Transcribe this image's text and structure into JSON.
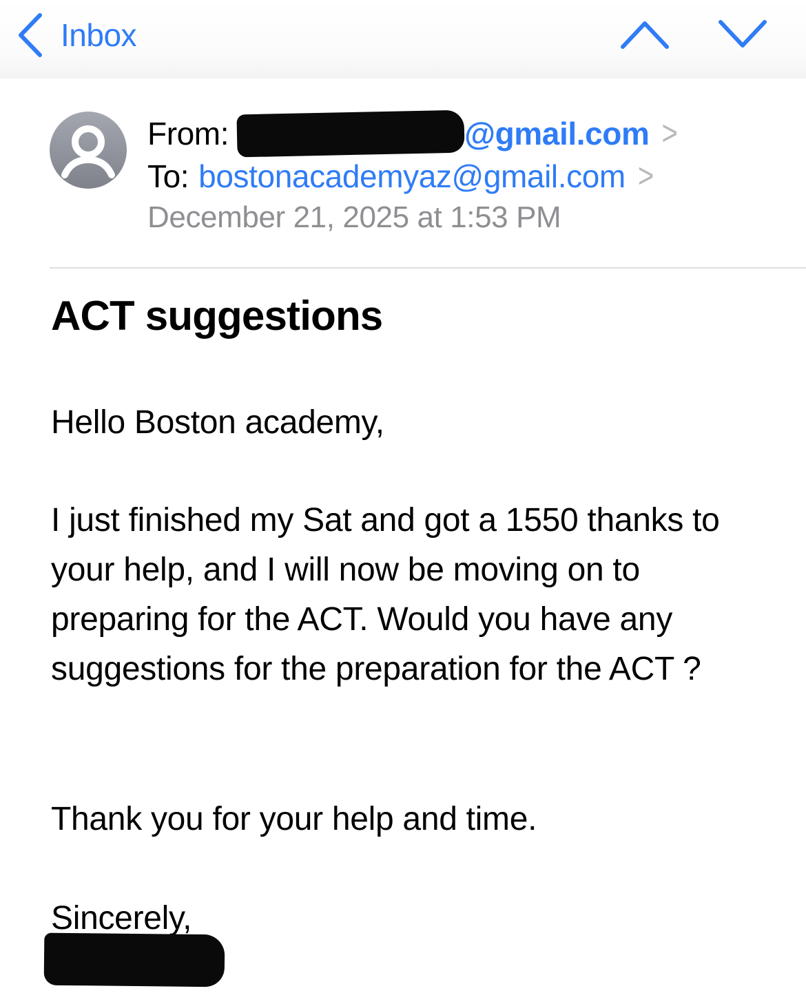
{
  "theme": {
    "accent": "#2f7cf6",
    "secondary_text": "#8e8e93",
    "disclosure": "#b8b8bd"
  },
  "nav": {
    "back_label": "Inbox",
    "back_icon": "chevron-left-icon",
    "prev_icon": "chevron-up-icon",
    "next_icon": "chevron-down-icon"
  },
  "header": {
    "avatar_icon": "person-icon",
    "from_label": "From:",
    "from_email_visible": "@gmail.com",
    "to_label": "To:",
    "to_email": "bostonacademyaz@gmail.com",
    "disclosure_glyph": ">",
    "date": "December 21, 2025 at 1:53 PM"
  },
  "message": {
    "subject": "ACT suggestions",
    "greeting": "Hello Boston academy,",
    "body": "I just finished my Sat and got a 1550 thanks to your help, and I will now be moving on to preparing for the ACT. Would you have any suggestions for the preparation for the ACT ?",
    "thanks": "Thank you for your help and time.",
    "closing": "Sincerely,"
  }
}
